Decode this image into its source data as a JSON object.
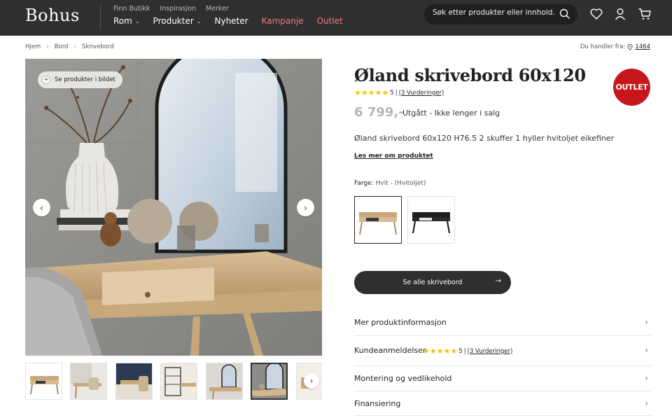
{
  "brand": {
    "logo_text": "Bohus"
  },
  "header": {
    "secondary_nav": [
      "Finn Butikk",
      "Inspirasjon",
      "Merker"
    ],
    "main_nav": [
      {
        "label": "Rom",
        "has_dropdown": true
      },
      {
        "label": "Produkter",
        "has_dropdown": true
      },
      {
        "label": "Nyheter",
        "has_dropdown": false
      },
      {
        "label": "Kampanje",
        "has_dropdown": false,
        "highlight": true
      },
      {
        "label": "Outlet",
        "has_dropdown": false,
        "highlight": true
      }
    ],
    "search_placeholder": "Søk etter produkter eller innhold...",
    "icons": [
      "search-icon",
      "heart-icon",
      "user-icon",
      "cart-icon"
    ],
    "highlight_color": "#f07a7a"
  },
  "breadcrumb": [
    "Hjem",
    "Bord",
    "Skrivebord"
  ],
  "store": {
    "label": "Du handler fra:",
    "number": "1464"
  },
  "gallery": {
    "see_products_label": "Se produkter i bildet",
    "thumbnail_count": 7,
    "active_thumbnail_index": 5
  },
  "product": {
    "title": "Øland skrivebord 60x120",
    "rating": {
      "stars": 5,
      "value": "5",
      "sep": "|",
      "count_label": "(3 Vurderinger)"
    },
    "badge": "OUTLET",
    "price": "6 799,-",
    "status": "Utgått - Ikke lenger i salg",
    "description": "Øland skrivebord 60x120 H76.5 2 skuffer 1 hyller hvitoljet eikefiner",
    "read_more": "Les mer om produktet",
    "color_label": "Farge:",
    "color_value": "Hvit - (Hvitoljet)",
    "cta_label": "Se alle skrivebord",
    "badge_color": "#c8161d"
  },
  "accordion": [
    {
      "label": "Mer produktinformasjon"
    },
    {
      "label": "Kundeanmeldelser"
    },
    {
      "label": "Montering og vedlikehold"
    },
    {
      "label": "Finansiering"
    }
  ]
}
